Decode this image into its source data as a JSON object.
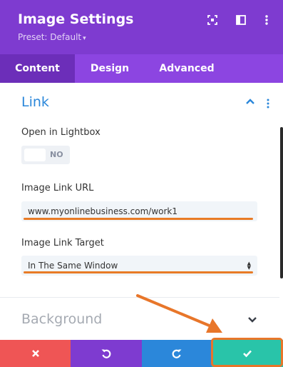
{
  "header": {
    "title": "Image Settings",
    "preset": "Preset: Default",
    "background_color": "#7e3bd0",
    "icons": [
      "focus-icon",
      "sidebar-layout-icon",
      "more-vertical-icon"
    ]
  },
  "tabs": [
    {
      "label": "Content",
      "active": true
    },
    {
      "label": "Design",
      "active": false
    },
    {
      "label": "Advanced",
      "active": false
    }
  ],
  "link_section": {
    "title": "Link",
    "accent_color": "#2b87da",
    "open_in_lightbox": {
      "label": "Open in Lightbox",
      "value": "NO"
    },
    "image_link_url": {
      "label": "Image Link URL",
      "value": "www.myonlinebusiness.com/work1"
    },
    "image_link_target": {
      "label": "Image Link Target",
      "value": "In The Same Window"
    }
  },
  "background_section": {
    "title": "Background"
  },
  "footer": {
    "buttons": [
      {
        "name": "discard",
        "icon": "close-icon",
        "color": "#ef5555"
      },
      {
        "name": "undo",
        "icon": "undo-icon",
        "color": "#7e3bd0"
      },
      {
        "name": "redo",
        "icon": "redo-icon",
        "color": "#2b87da"
      },
      {
        "name": "save",
        "icon": "check-icon",
        "color": "#29c4a9"
      }
    ]
  },
  "annotation_color": "#e8762a"
}
